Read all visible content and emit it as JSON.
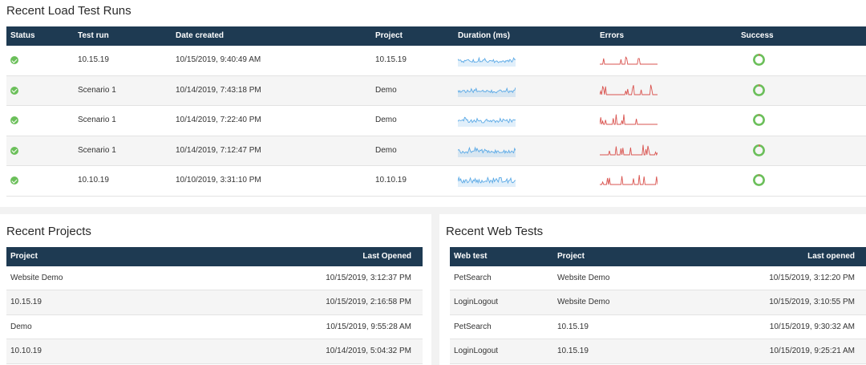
{
  "load_runs": {
    "title": "Recent Load Test Runs",
    "columns": [
      "Status",
      "Test run",
      "Date created",
      "Project",
      "Duration (ms)",
      "Errors",
      "Success"
    ],
    "rows": [
      {
        "test_run": "10.15.19",
        "date_created": "10/15/2019, 9:40:49 AM",
        "project": "10.15.19",
        "success_pct": 97
      },
      {
        "test_run": "Scenario 1",
        "date_created": "10/14/2019, 7:43:18 PM",
        "project": "Demo",
        "success_pct": 97
      },
      {
        "test_run": "Scenario 1",
        "date_created": "10/14/2019, 7:22:40 PM",
        "project": "Demo",
        "success_pct": 98
      },
      {
        "test_run": "Scenario 1",
        "date_created": "10/14/2019, 7:12:47 PM",
        "project": "Demo",
        "success_pct": 96
      },
      {
        "test_run": "10.10.19",
        "date_created": "10/10/2019, 3:31:10 PM",
        "project": "10.10.19",
        "success_pct": 98
      }
    ]
  },
  "projects": {
    "title": "Recent Projects",
    "columns": [
      "Project",
      "Last Opened"
    ],
    "rows": [
      {
        "project": "Website Demo",
        "last_opened": "10/15/2019, 3:12:37 PM"
      },
      {
        "project": "10.15.19",
        "last_opened": "10/15/2019, 2:16:58 PM"
      },
      {
        "project": "Demo",
        "last_opened": "10/15/2019, 9:55:28 AM"
      },
      {
        "project": "10.10.19",
        "last_opened": "10/14/2019, 5:04:32 PM"
      }
    ]
  },
  "web_tests": {
    "title": "Recent Web Tests",
    "columns": [
      "Web test",
      "Project",
      "Last opened"
    ],
    "rows": [
      {
        "web_test": "PetSearch",
        "project": "Website Demo",
        "last_opened": "10/15/2019, 3:12:20 PM"
      },
      {
        "web_test": "LoginLogout",
        "project": "Website Demo",
        "last_opened": "10/15/2019, 3:10:55 PM"
      },
      {
        "web_test": "PetSearch",
        "project": "10.15.19",
        "last_opened": "10/15/2019, 9:30:32 AM"
      },
      {
        "web_test": "LoginLogout",
        "project": "10.15.19",
        "last_opened": "10/15/2019, 9:25:21 AM"
      }
    ]
  },
  "colors": {
    "header": "#1e3a52",
    "success_green": "#6bbf5a",
    "duration_line": "#5aa9e6",
    "error_line": "#d9534f",
    "ring_fail": "#e0584f"
  },
  "icons": {
    "status": "check-circle-icon",
    "success": "success-ring-icon"
  }
}
